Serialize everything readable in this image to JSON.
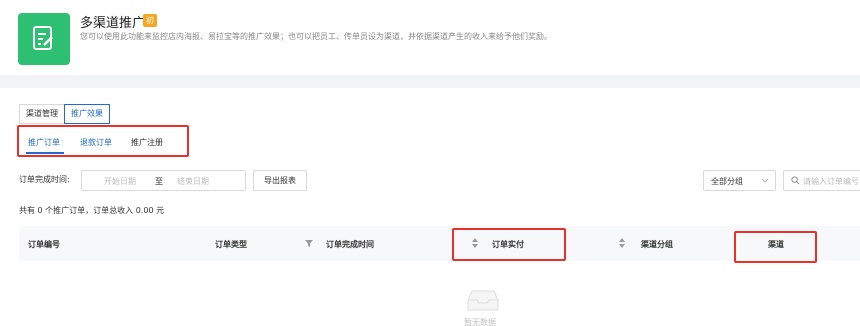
{
  "header": {
    "title": "多渠道推广",
    "badge": "初",
    "description": "您可以使用此功能来监控店内海报、易拉宝等的推广效果；也可以把员工、传单员设为渠道，并依据渠道产生的收入来给予他们奖励。",
    "icon": "document-edit-icon"
  },
  "tabs": [
    {
      "label": "渠道管理",
      "active": false
    },
    {
      "label": "推广效果",
      "active": true
    }
  ],
  "sub_tabs": [
    {
      "label": "推广订单",
      "active": true
    },
    {
      "label": "退款订单",
      "active": false
    },
    {
      "label": "推广注册",
      "active": false
    }
  ],
  "filter": {
    "date_label": "订单完成时间:",
    "start_placeholder": "开始日期",
    "separator": "至",
    "end_placeholder": "结束日期",
    "export_label": "导出报表",
    "group_select_value": "全部分组",
    "search_placeholder": "请输入订单编号"
  },
  "summary": "共有 0 个推广订单，订单总收入 0.00 元",
  "table": {
    "columns": [
      {
        "label": "订单编号"
      },
      {
        "label": "订单类型",
        "icon": "filter-icon"
      },
      {
        "label": "订单完成时间"
      },
      {
        "label": "订单实付",
        "icon": "sort-icon"
      },
      {
        "label": "渠道分组",
        "icon": "sort-icon"
      },
      {
        "label": "渠道"
      }
    ]
  },
  "empty": {
    "text": "暂无数据",
    "icon": "empty-inbox-icon"
  },
  "colors": {
    "accent": "#1f6ad6",
    "icon_bg": "#2dbf72",
    "badge": "#f5a623",
    "highlight": "#e8312b"
  }
}
